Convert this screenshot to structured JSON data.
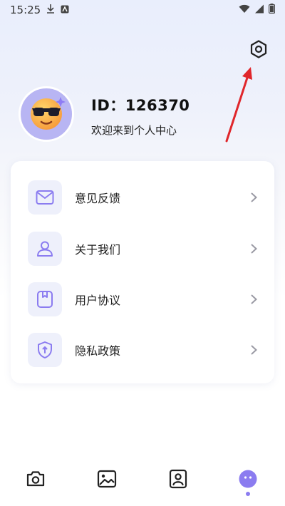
{
  "status_bar": {
    "time": "15:25",
    "icons": [
      "download-icon",
      "app-notification-icon",
      "wifi-icon",
      "signal-icon",
      "battery-icon"
    ]
  },
  "header": {
    "settings_icon": "hexagon-settings-icon",
    "annotation": "red-arrow-icon"
  },
  "profile": {
    "avatar": "sunglasses-emoji-avatar",
    "id_text": "ID：126370",
    "greeting": "欢迎来到个人中心"
  },
  "menu": {
    "items": [
      {
        "label": "意见反馈",
        "icon": "mail-icon"
      },
      {
        "label": "关于我们",
        "icon": "person-icon"
      },
      {
        "label": "用户协议",
        "icon": "document-icon"
      },
      {
        "label": "隐私政策",
        "icon": "shield-icon"
      }
    ]
  },
  "bottom_nav": {
    "items": [
      {
        "icon": "camera-icon",
        "active": false
      },
      {
        "icon": "image-icon",
        "active": false
      },
      {
        "icon": "portrait-icon",
        "active": false
      },
      {
        "icon": "profile-face-icon",
        "active": true
      }
    ]
  },
  "colors": {
    "accent": "#8b7cf0",
    "avatar_bg": "#b8b5f3",
    "icon_bg": "#eef0fb",
    "arrow": "#e0262b"
  }
}
